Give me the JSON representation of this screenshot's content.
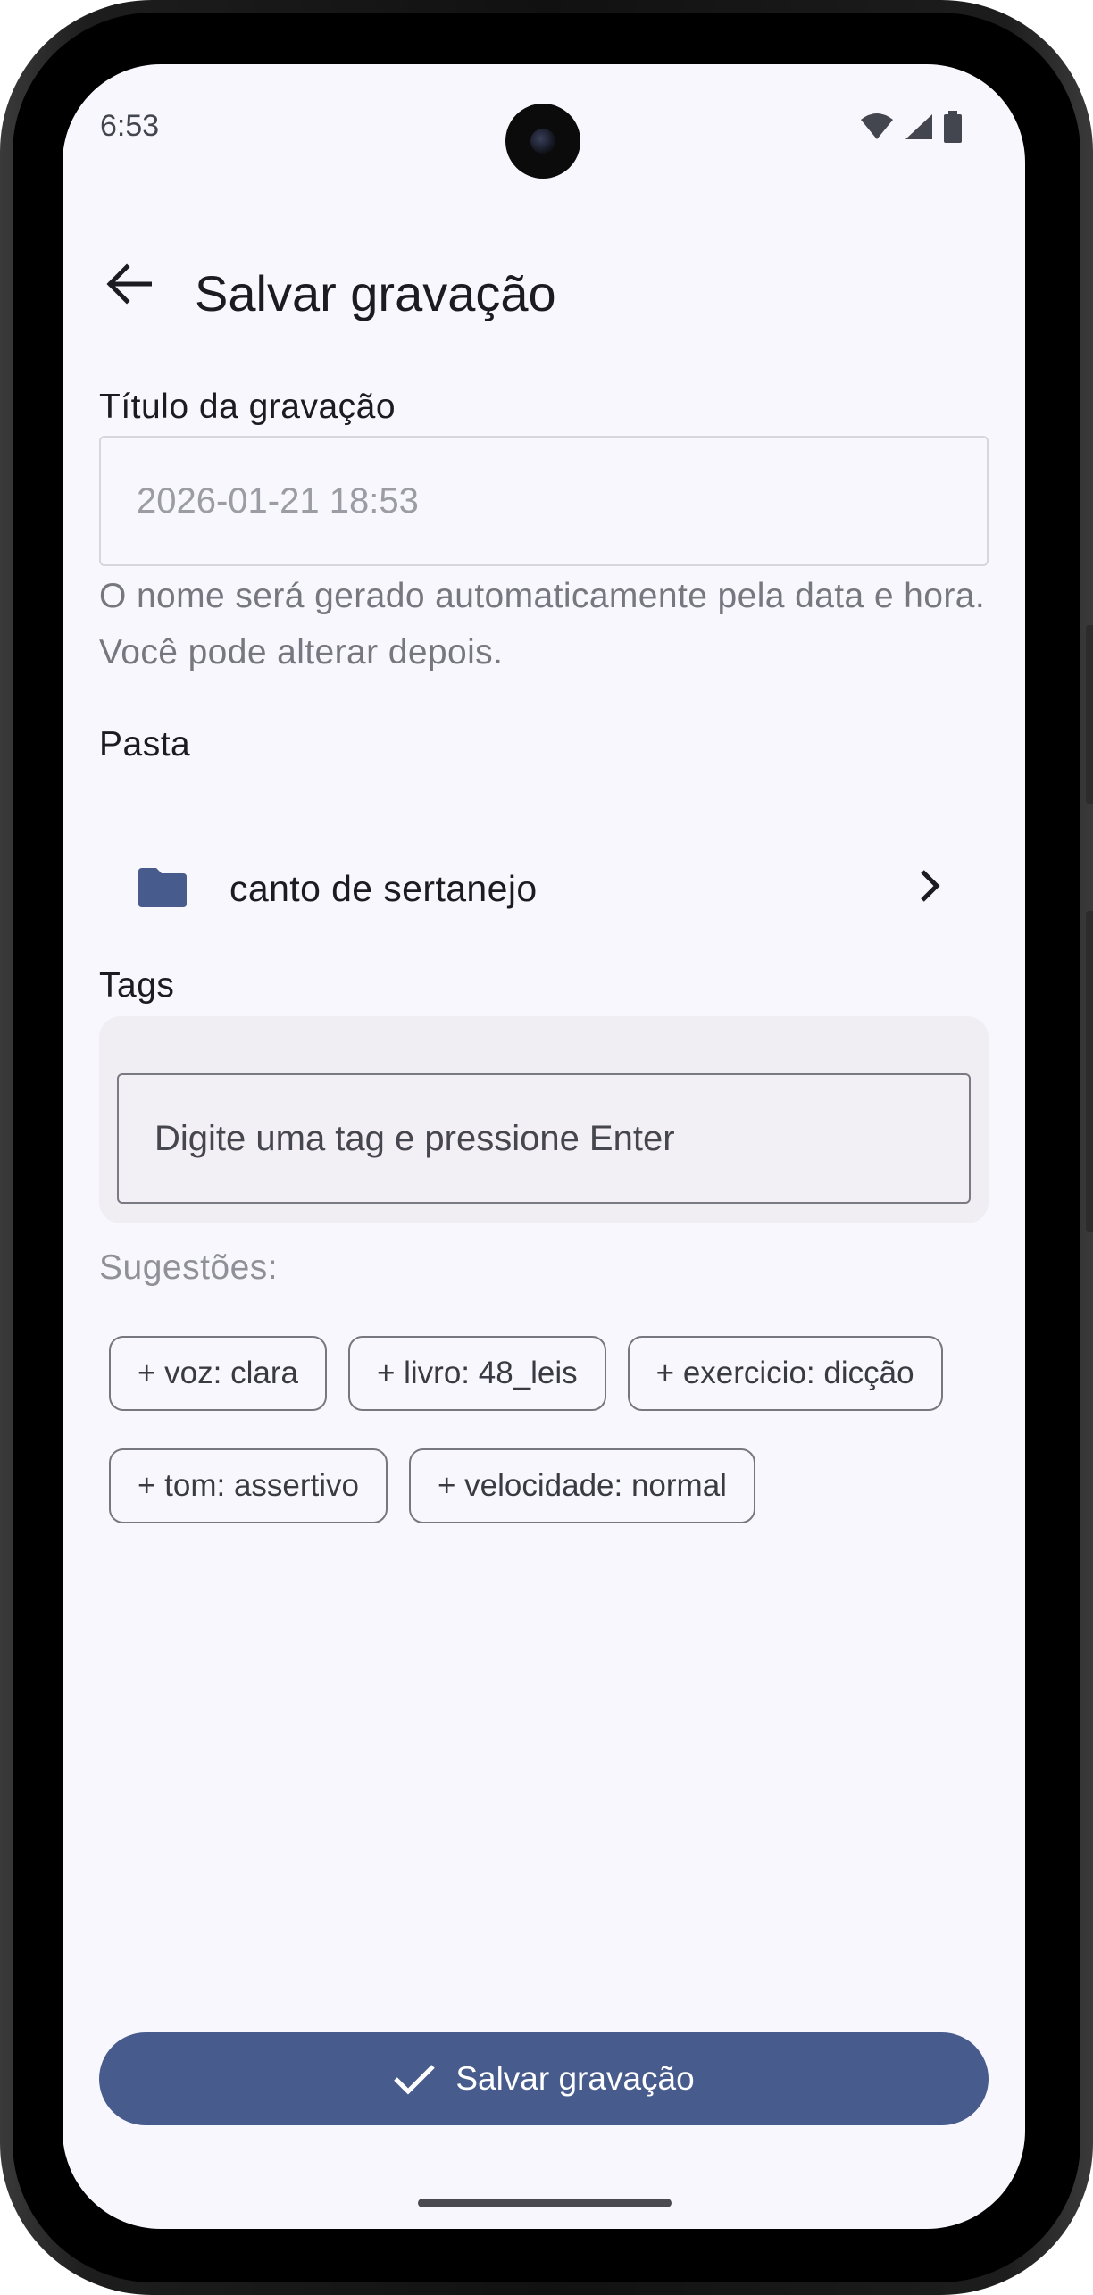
{
  "status_bar": {
    "time": "6:53",
    "icons": [
      "wifi-icon",
      "signal-icon",
      "battery-icon"
    ]
  },
  "app_bar": {
    "back_icon": "arrow-left-icon",
    "title": "Salvar gravação"
  },
  "title_field": {
    "label": "Título da gravação",
    "value": "",
    "placeholder": "2026-01-21 18:53",
    "helper": "O nome será gerado automaticamente pela data e hora. Você pode alterar depois."
  },
  "folder": {
    "label": "Pasta",
    "icon": "folder-icon",
    "name": "canto de sertanejo",
    "chevron_icon": "chevron-right-icon"
  },
  "tags": {
    "label": "Tags",
    "input_value": "",
    "placeholder": "Digite uma tag e pressione Enter",
    "suggestions_label": "Sugestões:",
    "suggestions": [
      "+ voz: clara",
      "+ livro: 48_leis",
      "+ exercicio: dicção",
      "+ tom: assertivo",
      "+ velocidade: normal"
    ]
  },
  "save_button": {
    "icon": "check-icon",
    "label": "Salvar gravação"
  },
  "colors": {
    "background": "#f8f7fd",
    "primary": "#475b8d",
    "text": "#1b1b21",
    "muted": "#777780"
  }
}
